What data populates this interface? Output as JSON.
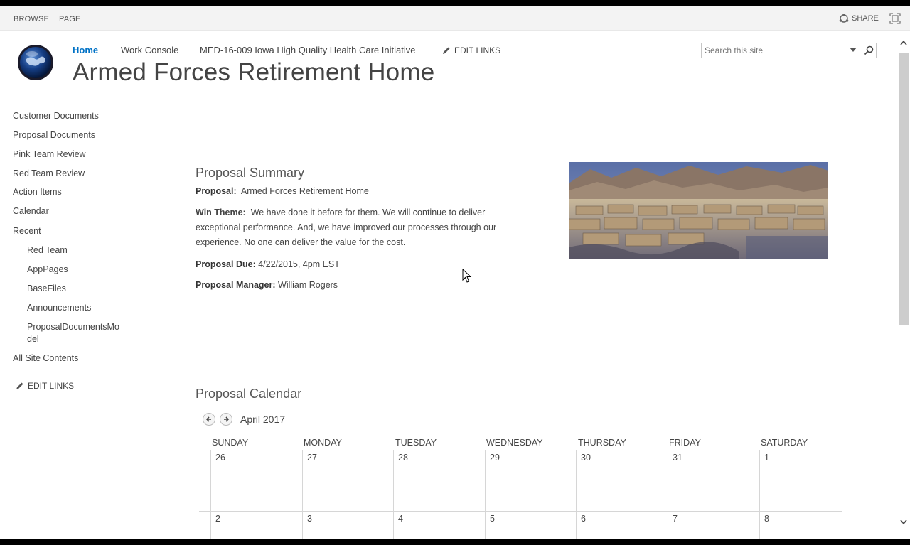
{
  "ribbon": {
    "tabs": [
      "BROWSE",
      "PAGE"
    ],
    "share_label": "SHARE"
  },
  "header": {
    "nav": [
      "Home",
      "Work Console",
      "MED-16-009 Iowa High Quality Health Care Initiative"
    ],
    "edit_links": "EDIT LINKS",
    "site_title": "Armed Forces Retirement Home",
    "search_placeholder": "Search this site"
  },
  "sidebar": {
    "items": [
      "Customer Documents",
      "Proposal Documents",
      "Pink Team Review",
      "Red Team Review",
      "Action Items",
      "Calendar",
      "Recent"
    ],
    "recent": [
      "Red Team",
      "AppPages",
      "BaseFiles",
      "Announcements",
      "ProposalDocumentsMo",
      "del"
    ],
    "all_site_contents": "All Site Contents",
    "edit_links": "EDIT LINKS"
  },
  "summary": {
    "heading": "Proposal Summary",
    "proposal_label": "Proposal:",
    "proposal_value": "Armed Forces Retirement Home",
    "win_theme_label": "Win Theme:",
    "win_theme_value": "We have done it before for them.  We will continue to deliver exceptional performance.  And, we have improved our processes through our experience.  No one can deliver the value for the cost.",
    "due_label": "Proposal Due:",
    "due_value": "4/22/2015, 4pm EST",
    "manager_label": "Proposal Manager:",
    "manager_value": "William Rogers"
  },
  "calendar": {
    "heading": "Proposal Calendar",
    "month": "April 2017",
    "days": [
      "SUNDAY",
      "MONDAY",
      "TUESDAY",
      "WEDNESDAY",
      "THURSDAY",
      "FRIDAY",
      "SATURDAY"
    ],
    "week1": [
      "26",
      "27",
      "28",
      "29",
      "30",
      "31",
      "1"
    ],
    "week2": [
      "2",
      "3",
      "4",
      "5",
      "6",
      "7",
      "8"
    ]
  },
  "colors": {
    "accent": "#0072c6",
    "text": "#444444",
    "ribbon_bg": "#f3f3f3"
  }
}
